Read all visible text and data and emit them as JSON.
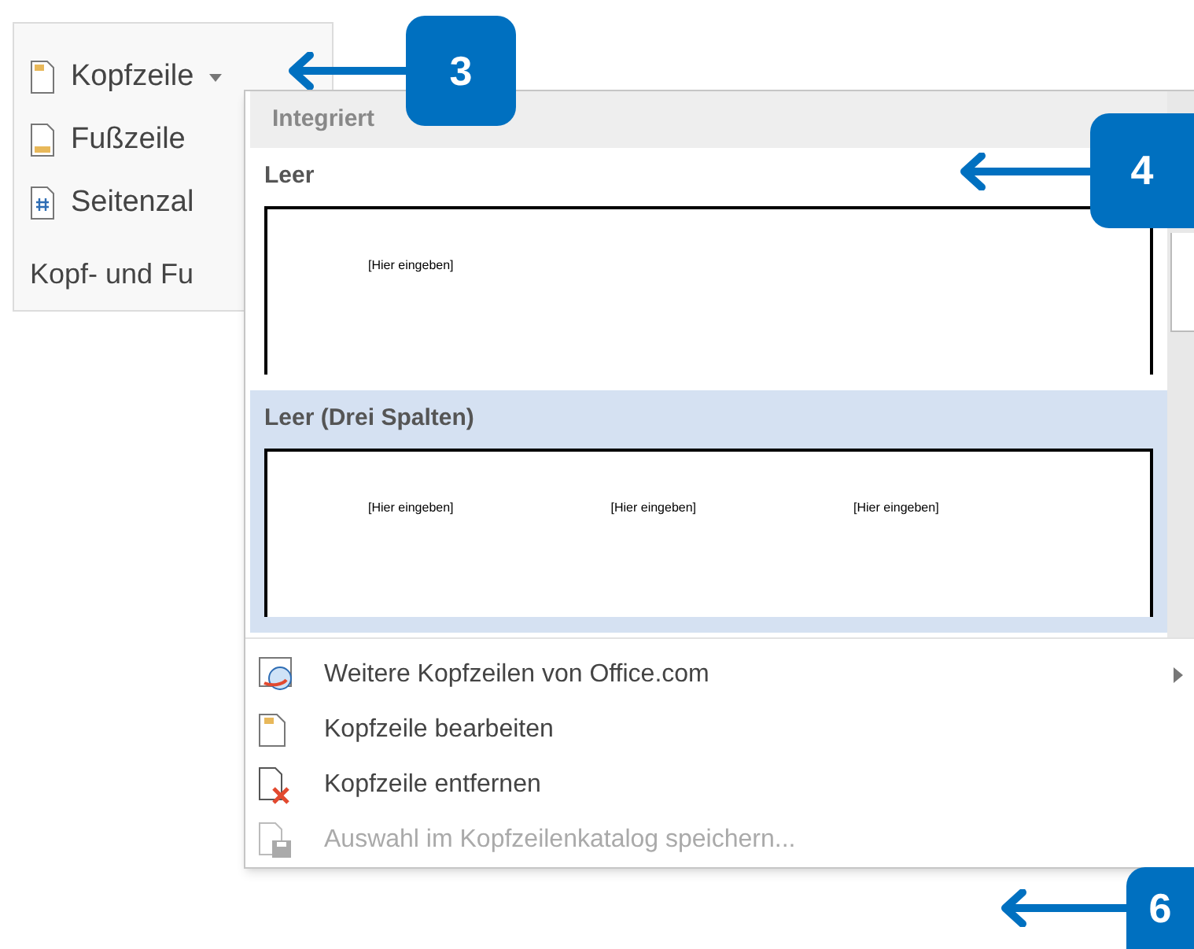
{
  "ribbon_group": {
    "items": [
      {
        "label": "Kopfzeile",
        "kind": "header",
        "dropdown": true
      },
      {
        "label": "Fußzeile",
        "kind": "footer",
        "dropdown": false
      },
      {
        "label": "Seitenzal",
        "kind": "pagenumber",
        "dropdown": false
      }
    ],
    "label": "Kopf- und Fu"
  },
  "menu": {
    "section": "Integriert",
    "gallery": [
      {
        "title": "Leer",
        "selected": false,
        "placeholders": [
          "[Hier eingeben]"
        ]
      },
      {
        "title": "Leer (Drei Spalten)",
        "selected": true,
        "placeholders": [
          "[Hier eingeben]",
          "[Hier eingeben]",
          "[Hier eingeben]"
        ]
      }
    ],
    "commands": [
      {
        "label": "Weitere Kopfzeilen von Office.com",
        "kind": "web",
        "submenu": true,
        "disabled": false
      },
      {
        "label": "Kopfzeile bearbeiten",
        "kind": "edit",
        "submenu": false,
        "disabled": false
      },
      {
        "label": "Kopfzeile entfernen",
        "kind": "remove",
        "submenu": false,
        "disabled": false
      },
      {
        "label": "Auswahl im Kopfzeilenkatalog speichern...",
        "kind": "save",
        "submenu": false,
        "disabled": true
      }
    ]
  },
  "callouts": [
    {
      "label": "3",
      "kind": "top"
    },
    {
      "label": "4",
      "kind": "middle"
    },
    {
      "label": "6",
      "kind": "bottom"
    }
  ]
}
